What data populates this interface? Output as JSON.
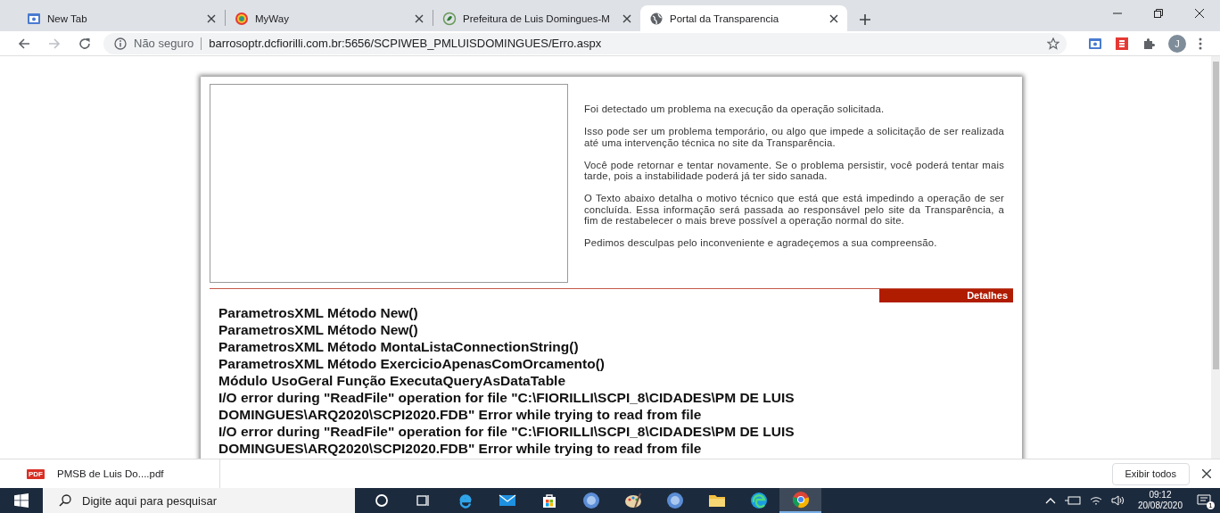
{
  "browser": {
    "tabs": [
      {
        "label": "New Tab",
        "kind": "newtab",
        "selected": false
      },
      {
        "label": "MyWay",
        "kind": "myway",
        "selected": false
      },
      {
        "label": "Prefeitura de Luis Domingues-M",
        "kind": "leaf",
        "selected": false
      },
      {
        "label": "Portal da Transparencia",
        "kind": "globe",
        "selected": true
      }
    ],
    "security": "Não seguro",
    "url": "barrosoptr.dcfiorilli.com.br:5656/SCPIWEB_PMLUISDOMINGUES/Erro.aspx",
    "profile": "J"
  },
  "page": {
    "paragraphs": [
      "Foi detectado um problema na execução da operação solicitada.",
      "Isso pode ser um problema temporário, ou algo que impede a solicitação de ser realizada até uma intervenção técnica no site da Transparência.",
      "Você pode retornar e tentar novamente. Se o problema persistir, você poderá tentar mais tarde, pois a instabilidade poderá já ter sido sanada.",
      "O Texto abaixo detalha o motivo técnico que está que está impedindo a operação de ser concluída. Essa informação será passada ao responsável pelo site da Transparência, a fim de restabelecer o mais breve possível a operação normal do site.",
      "Pedimos desculpas pelo inconveniente e agradeçemos a sua compreensão."
    ],
    "details_label": "Detalhes",
    "error_lines": [
      "ParametrosXML Método New()",
      "ParametrosXML Método New()",
      "ParametrosXML Método MontaListaConnectionString()",
      "ParametrosXML Método ExercicioApenasComOrcamento()",
      "Módulo UsoGeral Função ExecutaQueryAsDataTable",
      "I/O error during \"ReadFile\" operation for file \"C:\\FIORILLI\\SCPI_8\\CIDADES\\PM DE LUIS DOMINGUES\\ARQ2020\\SCPI2020.FDB\" Error while trying to read from file",
      "I/O error during \"ReadFile\" operation for file \"C:\\FIORILLI\\SCPI_8\\CIDADES\\PM DE LUIS DOMINGUES\\ARQ2020\\SCPI2020.FDB\" Error while trying to read from file"
    ]
  },
  "downloads": {
    "file_badge": "PDF",
    "file": "PMSB de Luis Do....pdf",
    "show_all": "Exibir todos"
  },
  "taskbar": {
    "search_placeholder": "Digite aqui para pesquisar",
    "apps": [
      {
        "kind": "cortana",
        "selected": false
      },
      {
        "kind": "taskview",
        "selected": false
      },
      {
        "kind": "ie",
        "selected": false
      },
      {
        "kind": "mail",
        "selected": false
      },
      {
        "kind": "store",
        "selected": false
      },
      {
        "kind": "bluecircle",
        "selected": false
      },
      {
        "kind": "paint",
        "selected": false
      },
      {
        "kind": "bluecircle",
        "selected": false
      },
      {
        "kind": "folder",
        "selected": false
      },
      {
        "kind": "edge",
        "selected": false
      },
      {
        "kind": "chrome",
        "selected": true
      }
    ],
    "time": "09:12",
    "date": "20/08/2020",
    "notifications": "1"
  }
}
